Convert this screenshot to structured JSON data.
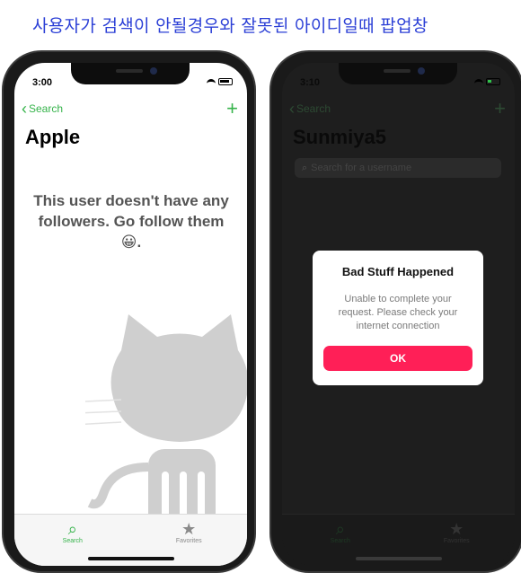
{
  "caption": "사용자가 검색이 안될경우와  잘못된 아이디일때 팝업창",
  "left_phone": {
    "status_time": "3:00",
    "back_label": "Search",
    "add_icon": "plus-icon",
    "title": "Apple",
    "empty_message": "This user doesn't have any followers. Go follow them 😀.",
    "tabs": [
      {
        "label": "Search",
        "icon": "search-icon",
        "active": true
      },
      {
        "label": "Favorites",
        "icon": "star-icon",
        "active": false
      }
    ]
  },
  "right_phone": {
    "status_time": "3:10",
    "back_label": "Search",
    "title": "Sunmiya5",
    "search_placeholder": "Search for a username",
    "alert": {
      "title": "Bad Stuff Happened",
      "message": "Unable to complete your request. Please check your internet connection",
      "ok_label": "OK"
    },
    "tabs": [
      {
        "label": "Search",
        "icon": "search-icon",
        "active": true
      },
      {
        "label": "Favorites",
        "icon": "star-icon",
        "active": false
      }
    ]
  },
  "colors": {
    "accent_green": "#35b34a",
    "alert_button": "#ff1f57",
    "caption_blue": "#2b3fd6"
  }
}
